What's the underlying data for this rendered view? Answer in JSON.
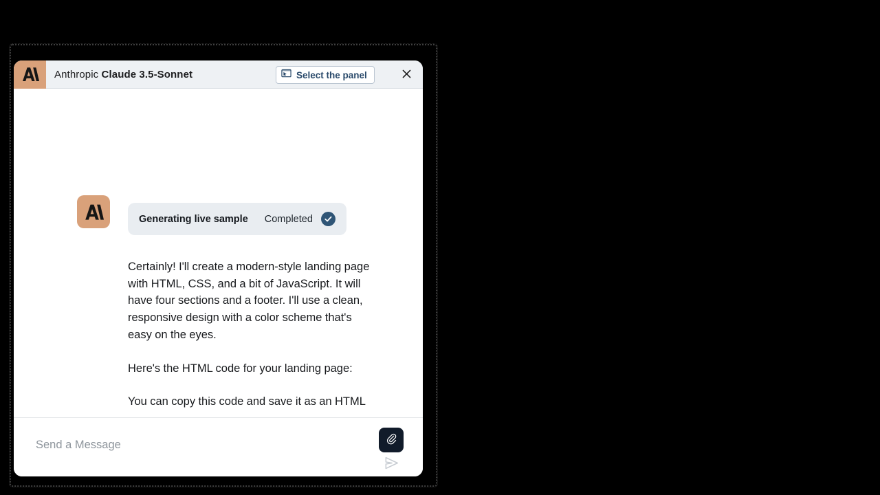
{
  "window": {
    "title_prefix": "Anthropic ",
    "title_model": "Claude 3.5-Sonnet",
    "logo_icon": "anthropic-logo-icon",
    "select_panel_label": "Select the panel",
    "select_panel_icon": "select-panel-icon",
    "close_icon": "close-icon",
    "colors": {
      "titlebar_bg": "#eef1f4",
      "brand_tan": "#d9a17a",
      "accent_blue": "#2a4a6b",
      "check_blue": "#2f5576",
      "card_bg": "#e9edf1",
      "attach_bg": "#111b2a",
      "text": "#17191c",
      "placeholder": "#8e959c"
    }
  },
  "conversation": {
    "avatar_icon": "anthropic-avatar-icon",
    "status_card": {
      "title": "Generating live sample",
      "state": "Completed",
      "check_icon": "check-circle-icon"
    },
    "paragraphs": [
      "Certainly! I'll create a modern-style landing page with HTML, CSS, and a bit of JavaScript. It will have four sections and a footer. I'll use a clean, responsive design with a color scheme that's easy on the eyes.",
      "Here's the HTML code for your landing page:",
      "You can copy this code and save it as an HTML file, then open it in a web browser to see the result. Feel free to customize the content, colors, or layout to better suit your specific needs."
    ]
  },
  "composer": {
    "placeholder": "Send a Message",
    "value": "",
    "attach_icon": "paperclip-icon",
    "send_icon": "send-icon"
  }
}
